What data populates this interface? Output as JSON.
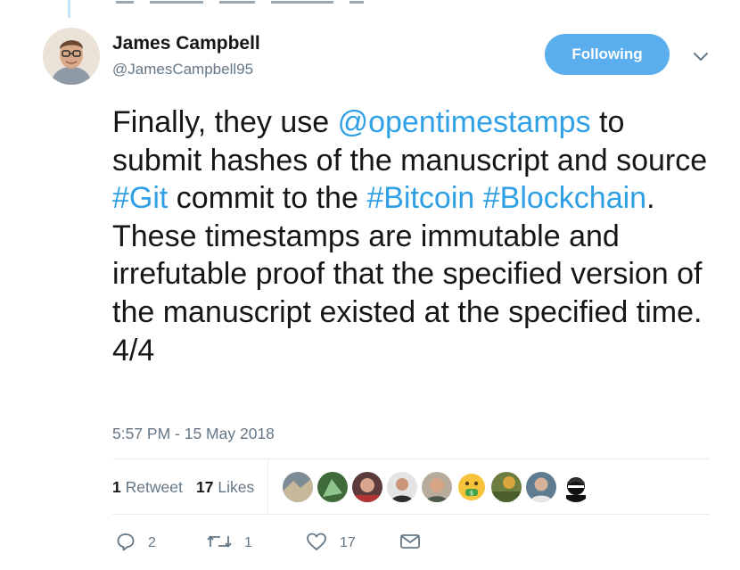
{
  "colors": {
    "accent": "#5aaeee",
    "link": "#2fa0e6",
    "muted": "#657786",
    "text": "#14171a"
  },
  "author": {
    "name": "James Campbell",
    "handle": "@JamesCampbell95"
  },
  "follow_button": {
    "label": "Following"
  },
  "tweet": {
    "t1": "Finally, they use ",
    "mention": "@opentimestamps",
    "t2": " to submit hashes of the manuscript and source ",
    "tag_git": "#Git",
    "t3": " commit to the ",
    "tag_bitcoin": "#Bitcoin",
    "t4": " ",
    "tag_blockchain": "#Blockchain",
    "t5": ". These timestamps are immutable and irrefutable proof that the specified version of the manuscript existed at the specified time.",
    "t6": "4/4"
  },
  "timestamp": "5:57 PM - 15 May 2018",
  "stats": {
    "retweets_count": "1",
    "retweets_label": "Retweet",
    "likes_count": "17",
    "likes_label": "Likes"
  },
  "liker_icons": [
    "avatar-icon",
    "avatar-icon",
    "avatar-icon",
    "avatar-icon",
    "avatar-icon",
    "money-mouth-emoji-icon",
    "avatar-icon",
    "avatar-icon",
    "avatar-icon"
  ],
  "actions": {
    "reply_count": "2",
    "retweet_count": "1",
    "like_count": "17"
  }
}
